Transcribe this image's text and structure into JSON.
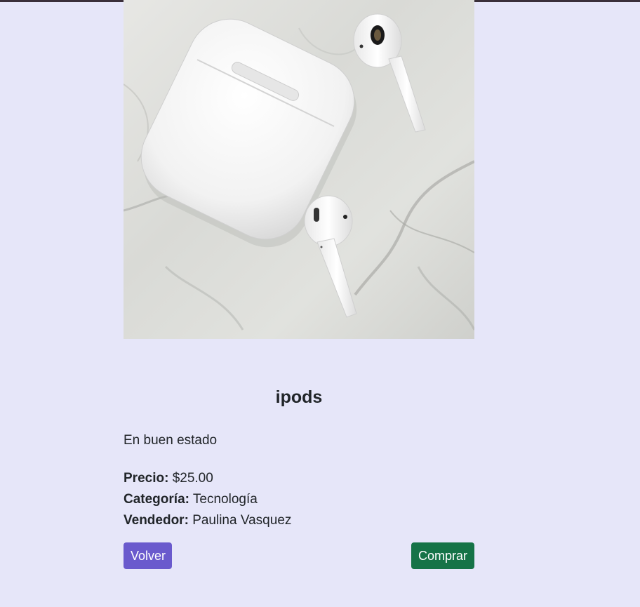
{
  "product": {
    "title": "ipods",
    "description": "En buen estado",
    "price_label": "Precio:",
    "price_value": "$25.00",
    "category_label": "Categoría:",
    "category_value": "Tecnología",
    "seller_label": "Vendedor:",
    "seller_value": "Paulina Vasquez"
  },
  "actions": {
    "back_label": "Volver",
    "buy_label": "Comprar"
  },
  "colors": {
    "page_background": "#e6e6f9",
    "back_button": "#6a5acd",
    "buy_button": "#157347"
  }
}
